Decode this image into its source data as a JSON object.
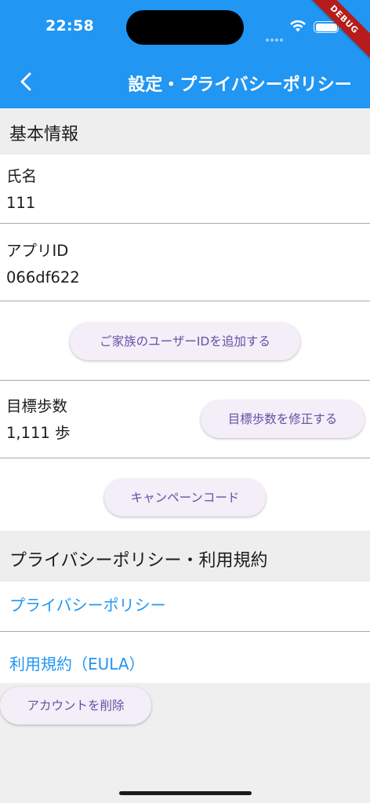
{
  "status": {
    "time": "22:58"
  },
  "debug_banner": "DEBUG",
  "header": {
    "title": "設定・プライバシーポリシー"
  },
  "basic": {
    "section_title": "基本情報",
    "name_label": "氏名",
    "name_value": "111",
    "appid_label": "アプリID",
    "appid_value": "066df622",
    "add_family_button": "ご家族のユーザーIDを追加する",
    "goal_label": "目標歩数",
    "goal_value": "1,111 歩",
    "edit_goal_button": "目標歩数を修正する",
    "campaign_button": "キャンペーンコード"
  },
  "privacy": {
    "section_title": "プライバシーポリシー・利用規約",
    "privacy_link": "プライバシーポリシー",
    "eula_link": "利用規約（EULA）",
    "delete_account_button": "アカウントを削除"
  },
  "colors": {
    "primary": "#2196f3",
    "button_bg": "#f3eef8",
    "button_text": "#6650a4",
    "debug": "#b71c1c"
  },
  "icons": [
    "back-arrow-icon",
    "wifi-icon",
    "battery-icon",
    "signal-icon"
  ]
}
